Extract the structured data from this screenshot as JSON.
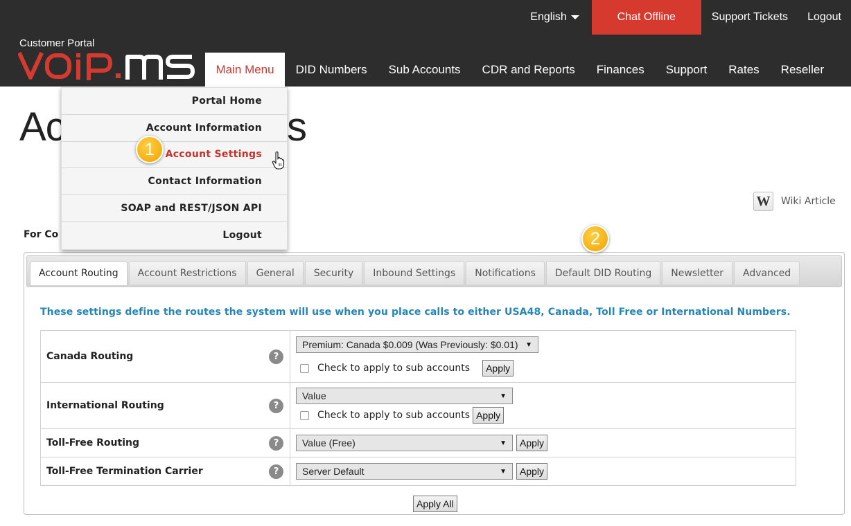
{
  "header": {
    "utility": {
      "language": "English",
      "chat": "Chat Offline",
      "tickets": "Support Tickets",
      "logout": "Logout"
    },
    "logo_caption": "Customer Portal",
    "logo_text": "VOiP.MS",
    "nav": [
      "Main Menu",
      "DID Numbers",
      "Sub Accounts",
      "CDR and Reports",
      "Finances",
      "Support",
      "Rates",
      "Reseller"
    ]
  },
  "colors": {
    "header_bg": "#2d2d2d",
    "brand_red": "#d63a2f",
    "intro_blue": "#2386b7",
    "badge_orange": "#f0a300"
  },
  "page": {
    "title_start": "Ac",
    "title_end": "gs",
    "for_text": "For Co",
    "wiki_label": "Wiki Article"
  },
  "main_menu": [
    "Portal Home",
    "Account Information",
    "Account Settings",
    "Contact Information",
    "SOAP and REST/JSON API",
    "Logout"
  ],
  "tabs": [
    "Account Routing",
    "Account Restrictions",
    "General",
    "Security",
    "Inbound Settings",
    "Notifications",
    "Default DID Routing",
    "Newsletter",
    "Advanced"
  ],
  "routing": {
    "intro": "These settings define the routes the system will use when you place calls to either USA48, Canada, Toll Free or International Numbers.",
    "check_label": "Check to apply to sub accounts",
    "apply_label": "Apply",
    "apply_all_label": "Apply All",
    "rows": [
      {
        "label": "Canada Routing",
        "value": "Premium: Canada $0.009 (Was Previously: $0.01)"
      },
      {
        "label": "International Routing",
        "value": "Value"
      },
      {
        "label": "Toll-Free Routing",
        "value": "Value (Free)"
      },
      {
        "label": "Toll-Free Termination Carrier",
        "value": "Server Default"
      }
    ]
  },
  "annotations": {
    "step_one": "1",
    "step_two": "2"
  }
}
